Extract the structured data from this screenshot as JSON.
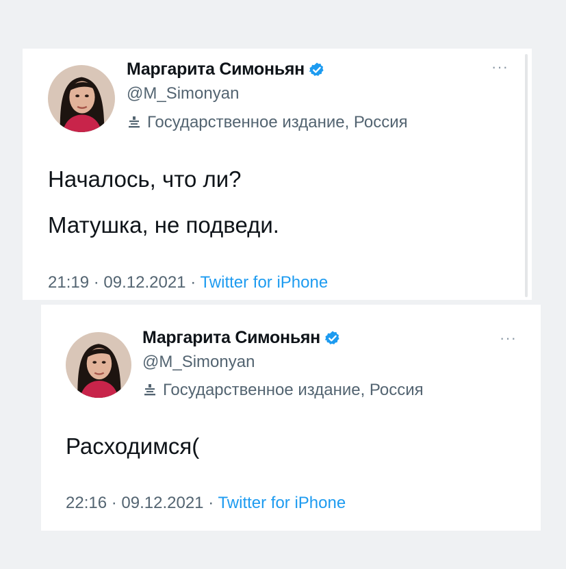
{
  "tweets": [
    {
      "author_name": "Маргарита Симоньян",
      "handle": "@M_Simonyan",
      "affiliation_label": "Государственное издание, Россия",
      "lines": [
        "Началось, что ли?",
        "Матушка, не подведи."
      ],
      "time": "21:19",
      "date": "09.12.2021",
      "separator": "·",
      "source": "Twitter for iPhone",
      "more_label": "···"
    },
    {
      "author_name": "Маргарита Симоньян",
      "handle": "@M_Simonyan",
      "affiliation_label": "Государственное издание, Россия",
      "lines": [
        "Расходимся("
      ],
      "time": "22:16",
      "date": "09.12.2021",
      "separator": "·",
      "source": "Twitter for iPhone",
      "more_label": "···"
    }
  ],
  "icons": {
    "verified": "verified-badge-icon",
    "state_media": "state-media-podium-icon",
    "more": "more-options-icon"
  },
  "colors": {
    "verified_blue": "#1d9bf0",
    "link_blue": "#1d9bf0",
    "secondary_text": "#536471",
    "primary_text": "#0f1419",
    "background": "#eff1f3",
    "card": "#ffffff"
  }
}
